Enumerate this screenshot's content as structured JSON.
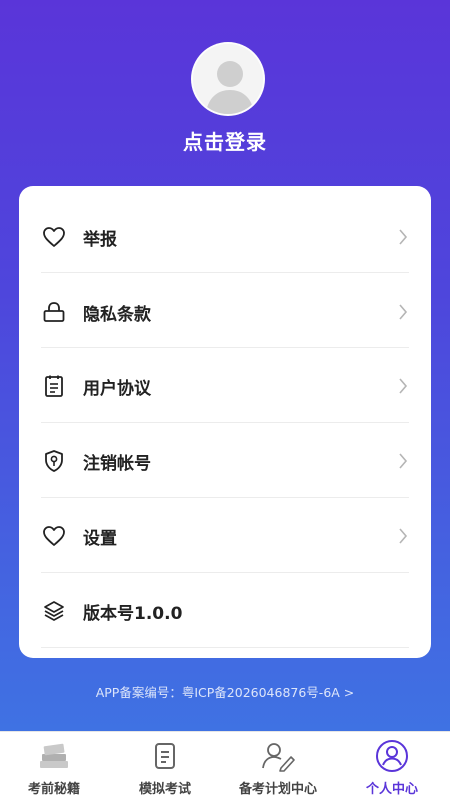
{
  "profile": {
    "login_text": "点击登录"
  },
  "menu": {
    "items": [
      {
        "label": "举报",
        "icon": "heart-icon"
      },
      {
        "label": "隐私条款",
        "icon": "lock-icon"
      },
      {
        "label": "用户协议",
        "icon": "document-icon"
      },
      {
        "label": "注销帐号",
        "icon": "shield-key-icon"
      },
      {
        "label": "设置",
        "icon": "heart-icon"
      },
      {
        "label": "版本号1.0.0",
        "icon": "layers-icon"
      }
    ]
  },
  "footer": {
    "record_text": "APP备案编号：粤ICP备2026046876号-6A >"
  },
  "tabbar": {
    "tabs": [
      {
        "label": "考前秘籍",
        "icon": "books-icon",
        "active": false
      },
      {
        "label": "模拟考试",
        "icon": "exam-sheet-icon",
        "active": false
      },
      {
        "label": "备考计划中心",
        "icon": "user-edit-icon",
        "active": false
      },
      {
        "label": "个人中心",
        "icon": "user-circle-icon",
        "active": true
      }
    ]
  },
  "colors": {
    "accent": "#5a35d9",
    "gradient_top": "#5a35d9",
    "gradient_bottom": "#3f72e3"
  }
}
